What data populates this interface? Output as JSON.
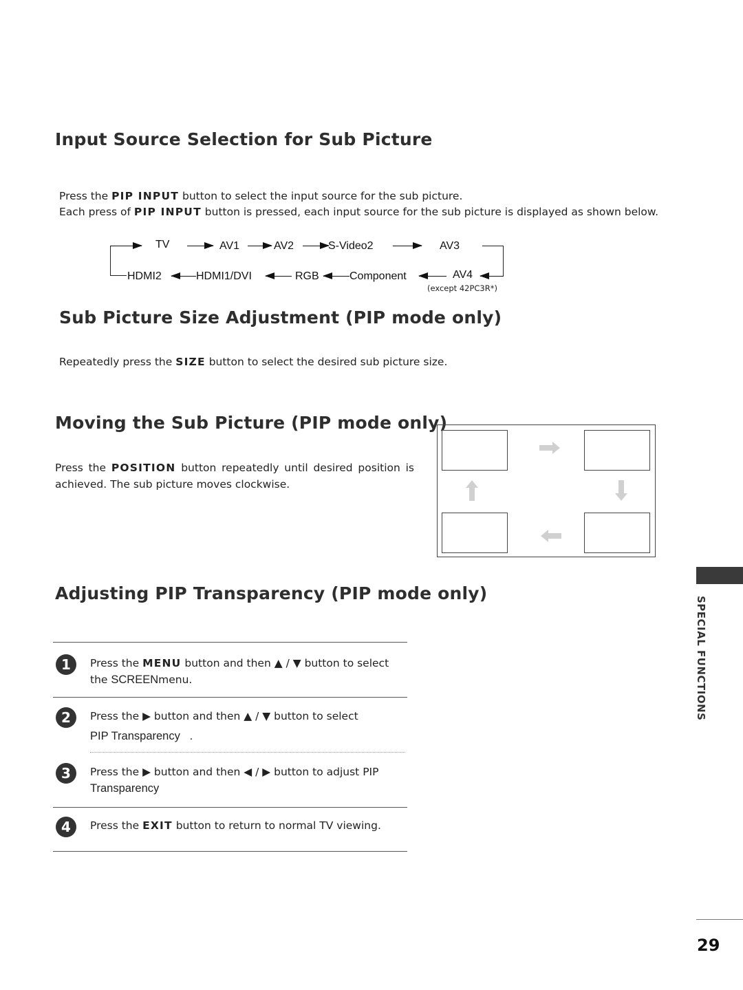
{
  "sections": {
    "input_source": {
      "title": "Input Source Selection for Sub Picture",
      "line1": {
        "pre": "Press the ",
        "key": "PIP INPUT",
        "post": " button to select the input source for the sub picture."
      },
      "line2": {
        "pre": "Each press of ",
        "key": "PIP INPUT",
        "post": " button is pressed, each input source for the sub picture is displayed as shown below."
      },
      "flow": {
        "top_row": [
          "TV",
          "AV1",
          "AV2",
          "S-Video2",
          "AV3"
        ],
        "bottom_row": [
          "HDMI2",
          "HDMI1/DVI",
          "RGB",
          "Component",
          "AV4"
        ],
        "note": "(except 42PC3R*)"
      }
    },
    "size": {
      "title": "Sub Picture Size Adjustment (PIP mode only)",
      "text": {
        "pre": "Repeatedly press the ",
        "key": "SIZE",
        "post": " button to select the desired sub picture size."
      }
    },
    "moving": {
      "title": "Moving the Sub Picture (PIP mode only)",
      "line1": {
        "pre": "Press the ",
        "key": "POSITION",
        "post": " button repeatedly until desired position is"
      },
      "line2": "achieved. The sub picture moves clockwise.",
      "diagram": {
        "arrows": [
          "arrow-right-icon",
          "arrow-down-icon",
          "arrow-left-icon",
          "arrow-up-icon"
        ]
      }
    },
    "transparency": {
      "title": "Adjusting PIP Transparency (PIP mode only)",
      "steps": [
        {
          "num": "1",
          "pre": "Press the ",
          "key": "MENU",
          "mid": " button and then ▲ / ▼ button to select",
          "line2_pre": "the ",
          "line2_sans": "SCREEN",
          "line2_post": "menu."
        },
        {
          "num": "2",
          "line1": "Press the ▶ button and then ▲ / ▼ button to select",
          "line2_sans": "PIP Transparency   ."
        },
        {
          "num": "3",
          "line1": "Press the ▶ button and then ◀ / ▶ button to adjust PIP",
          "line2_sans": "Transparency"
        },
        {
          "num": "4",
          "pre": "Press the ",
          "key": "EXIT",
          "post": " button to return to normal TV viewing."
        }
      ]
    }
  },
  "sidebar": {
    "label": "SPECIAL FUNCTIONS"
  },
  "page_number": "29"
}
